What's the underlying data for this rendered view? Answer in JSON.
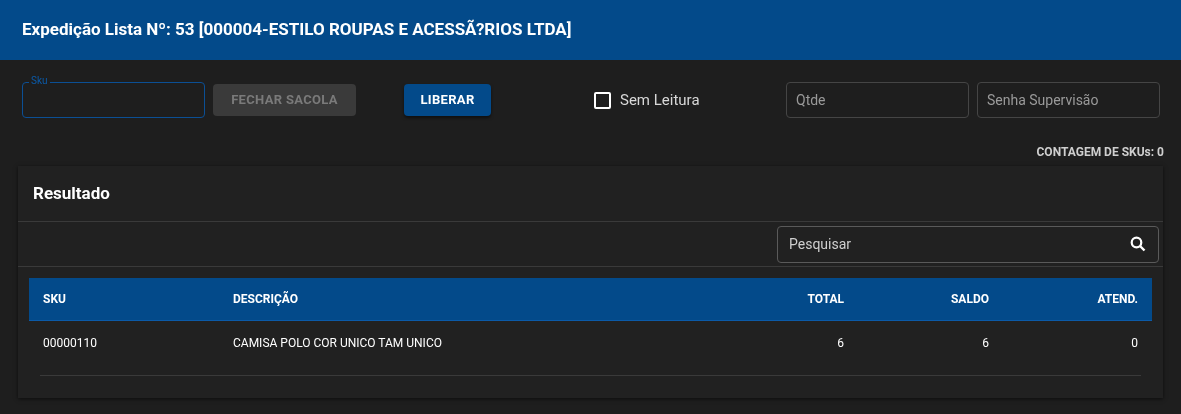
{
  "header": {
    "title": "Expedição Lista Nº: 53 [000004-ESTILO ROUPAS E ACESSÃ?RIOS LTDA]"
  },
  "toolbar": {
    "sku_field": {
      "label": "Sku"
    },
    "buttons": [
      {
        "label": "FECHAR SACOLA",
        "disabled": true
      },
      {
        "label": "LIBERAR",
        "disabled": false
      }
    ],
    "checkbox": {
      "label": "Sem Leitura",
      "checked": false
    },
    "fields": [
      {
        "placeholder": "Qtde"
      },
      {
        "placeholder": "Senha Supervisão"
      }
    ]
  },
  "sku_count": "CONTAGEM DE SKUs: 0",
  "panel": {
    "title": "Resultado",
    "search": {
      "placeholder": "Pesquisar"
    },
    "table": {
      "columns": [
        {
          "label": "SKU",
          "kind": "text"
        },
        {
          "label": "DESCRIÇÃO",
          "kind": "text"
        },
        {
          "label": "TOTAL",
          "kind": "number"
        },
        {
          "label": "SALDO",
          "kind": "number"
        },
        {
          "label": "ATEND.",
          "kind": "number"
        }
      ],
      "rows": [
        [
          "00000110",
          "CAMISA POLO COR UNICO TAM UNICO",
          "6",
          "6",
          "0"
        ]
      ]
    }
  }
}
